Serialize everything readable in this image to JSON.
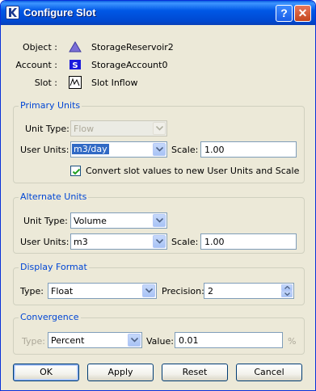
{
  "window": {
    "title": "Configure Slot"
  },
  "info": {
    "object": {
      "label": "Object :",
      "value": "StorageReservoir2",
      "icon": "reservoir-triangle-icon"
    },
    "account": {
      "label": "Account :",
      "value": "StorageAccount0",
      "icon": "storage-account-icon",
      "icon_text": "S"
    },
    "slot": {
      "label": "Slot :",
      "value": "Slot Inflow",
      "icon": "series-slot-icon"
    }
  },
  "primary_units": {
    "title": "Primary Units",
    "unit_type_label": "Unit Type:",
    "unit_type_value": "Flow",
    "user_units_label": "User Units:",
    "user_units_value": "m3/day",
    "scale_label": "Scale:",
    "scale_value": "1.00",
    "convert_label": "Convert slot values to new User Units and Scale",
    "convert_checked": true
  },
  "alternate_units": {
    "title": "Alternate Units",
    "unit_type_label": "Unit Type:",
    "unit_type_value": "Volume",
    "user_units_label": "User Units:",
    "user_units_value": "m3",
    "scale_label": "Scale:",
    "scale_value": "1.00"
  },
  "display_format": {
    "title": "Display Format",
    "type_label": "Type:",
    "type_value": "Float",
    "precision_label": "Precision:",
    "precision_value": "2"
  },
  "convergence": {
    "title": "Convergence",
    "type_label": "Type:",
    "type_value": "Percent",
    "value_label": "Value:",
    "value_value": "0.01",
    "unit_suffix": "%"
  },
  "buttons": {
    "ok": "OK",
    "apply": "Apply",
    "reset": "Reset",
    "cancel": "Cancel"
  },
  "colors": {
    "title_bar": "#0054e3",
    "group_title": "#0046d5",
    "selection": "#316ac5",
    "dialog_bg": "#ece9d8"
  }
}
